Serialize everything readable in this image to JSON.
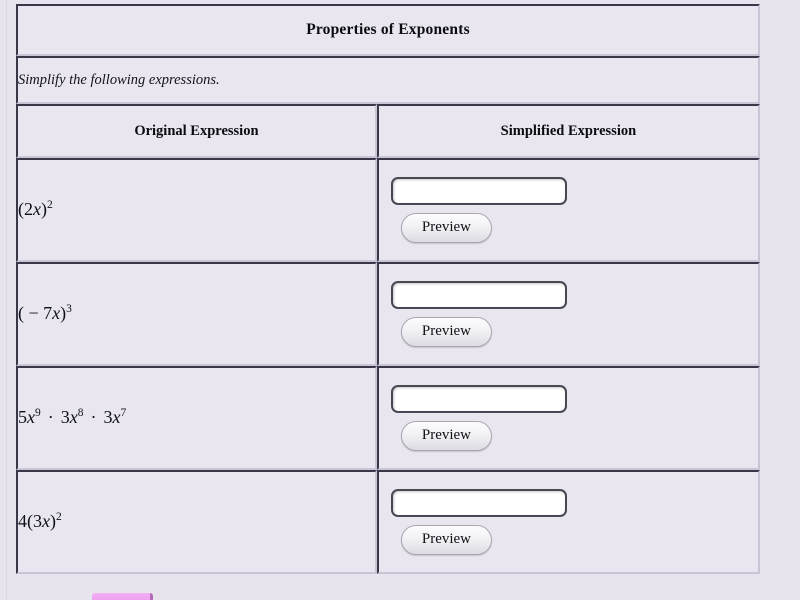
{
  "page": {
    "background_color": "#e7e4ee",
    "cell_background_color": "#e9e6f0",
    "border_color": "#3a3748",
    "accent_pink": "#eea3f0"
  },
  "quiz": {
    "title": "Properties of Exponents",
    "instruction": "Simplify the following expressions.",
    "columns": {
      "original": "Original Expression",
      "simplified": "Simplified Expression"
    },
    "rows": [
      {
        "expression_plain": "(2x)^2",
        "base": "(2",
        "var": "x",
        "close": ")",
        "exponent": "2",
        "input_value": "",
        "input_placeholder": "",
        "button_label": "Preview"
      },
      {
        "expression_plain": "( - 7x)^3",
        "base": "( − 7",
        "var": "x",
        "close": ")",
        "exponent": "3",
        "input_value": "",
        "input_placeholder": "",
        "button_label": "Preview"
      },
      {
        "expression_plain": "5x^9 · 3x^8 · 3x^7",
        "terms": [
          {
            "coefficient": "5",
            "var": "x",
            "exponent": "9"
          },
          {
            "coefficient": "3",
            "var": "x",
            "exponent": "8"
          },
          {
            "coefficient": "3",
            "var": "x",
            "exponent": "7"
          }
        ],
        "operator": "·",
        "input_value": "",
        "input_placeholder": "",
        "button_label": "Preview"
      },
      {
        "expression_plain": "4(3x)^2",
        "base": "4(3",
        "var": "x",
        "close": ")",
        "exponent": "2",
        "input_value": "",
        "input_placeholder": "",
        "button_label": "Preview"
      }
    ]
  },
  "footer": {
    "partial_button_visible": true
  }
}
